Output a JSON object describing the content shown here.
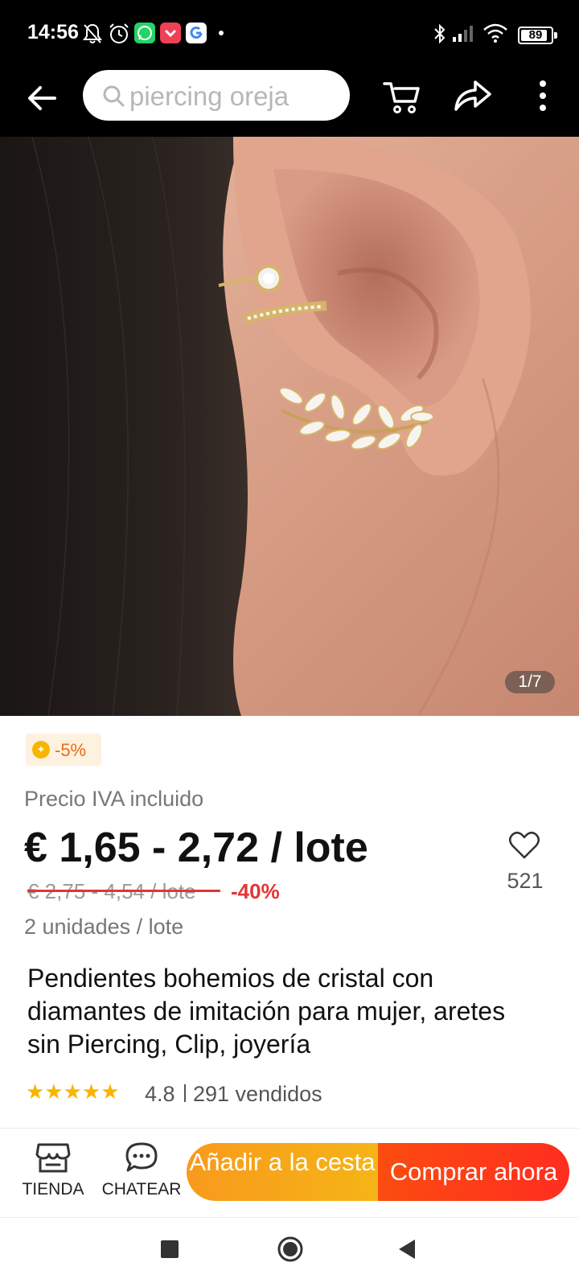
{
  "status_bar": {
    "time": "14:56",
    "battery": "89",
    "battery_level": 0.89,
    "left_icons": [
      "mute-icon",
      "alarm-icon",
      "whatsapp-icon",
      "pocket-icon",
      "google-icon",
      "dot-icon"
    ],
    "right_icons": [
      "bluetooth-icon",
      "signal-icon",
      "wifi-icon",
      "battery-icon"
    ]
  },
  "top_bar": {
    "search_text": "piercing oreja",
    "icons": [
      "back-arrow-icon",
      "search-icon",
      "cart-icon",
      "share-icon",
      "more-vertical-icon"
    ]
  },
  "gallery": {
    "counter": "1/7"
  },
  "product": {
    "discount_badge": "-5%",
    "vat_note": "Precio IVA incluido",
    "price": "€ 1,65 - 2,72 / lote",
    "old_price": "€ 2,75 - 4,54 / lote",
    "price_discount": "-40%",
    "unit_note": "2 unidades / lote",
    "wishlist_count": "521",
    "title": "Pendientes bohemios de cristal con diamantes de imitación para mujer, aretes sin Piercing, Clip, joyería",
    "stars": "★★★★★",
    "rating": "4.8",
    "sold": "291 vendidos"
  },
  "actions": {
    "store_label": "TIENDA",
    "chat_label": "CHATEAR",
    "add_to_cart_label": "Añadir a la cesta",
    "buy_now_label": "Comprar ahora"
  },
  "colors": {
    "price_red": "#e23535",
    "cart_orange": "#f89a1d",
    "buy_red": "#fc4c10",
    "star_gold": "#f7b500"
  }
}
